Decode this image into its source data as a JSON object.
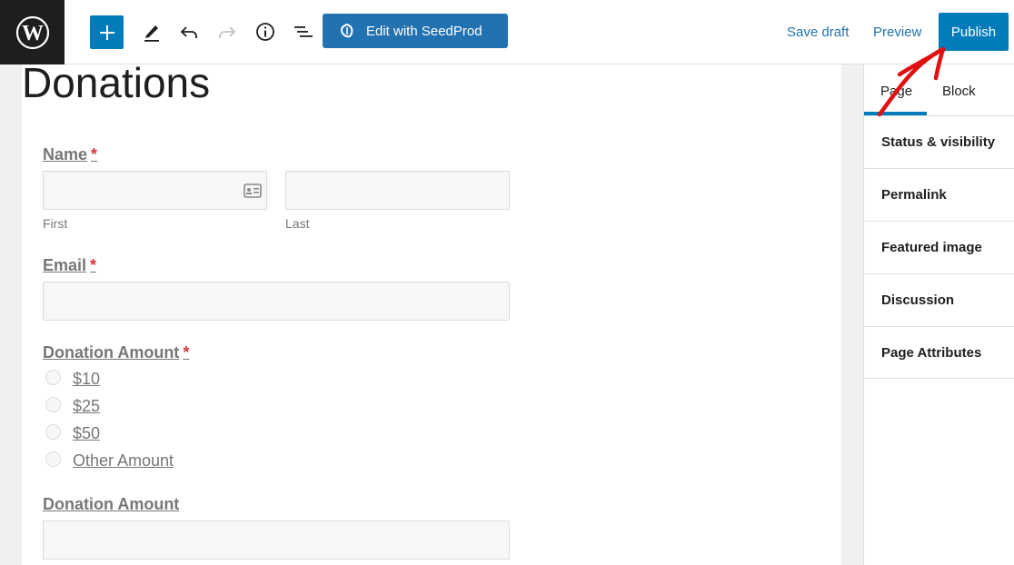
{
  "toolbar": {
    "seedprod_label": "Edit with SeedProd",
    "save_draft": "Save draft",
    "preview": "Preview",
    "publish": "Publish",
    "icons": [
      "wordpress-logo",
      "plus-icon",
      "pencil-icon",
      "undo-icon",
      "redo-icon",
      "info-icon",
      "list-view-icon",
      "seedprod-leaf-icon"
    ]
  },
  "page": {
    "title": "Donations"
  },
  "form": {
    "name": {
      "label": "Name",
      "required": "*",
      "first": "First",
      "last": "Last"
    },
    "email": {
      "label": "Email",
      "required": "*"
    },
    "donation_choice": {
      "label": "Donation Amount",
      "required": "*",
      "options": [
        "$10",
        "$25",
        "$50",
        "Other Amount"
      ]
    },
    "donation_amount": {
      "label": "Donation Amount"
    }
  },
  "sidebar": {
    "tabs": [
      "Page",
      "Block"
    ],
    "active_tab": "Page",
    "panels": [
      "Status & visibility",
      "Permalink",
      "Featured image",
      "Discussion",
      "Page Attributes"
    ]
  },
  "colors": {
    "accent": "#007cba",
    "seedprod": "#2271b1",
    "required": "#d63638",
    "annotation": "#e01010"
  }
}
